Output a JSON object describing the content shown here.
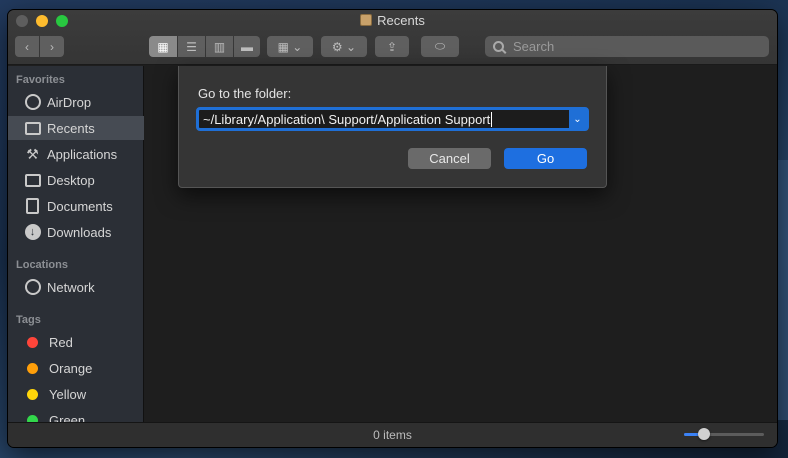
{
  "window": {
    "title": "Recents"
  },
  "search": {
    "placeholder": "Search"
  },
  "sidebar": {
    "favorites_header": "Favorites",
    "favorites": [
      {
        "label": "AirDrop",
        "icon": "airdrop-icon"
      },
      {
        "label": "Recents",
        "icon": "recents-icon",
        "selected": true
      },
      {
        "label": "Applications",
        "icon": "applications-icon"
      },
      {
        "label": "Desktop",
        "icon": "desktop-icon"
      },
      {
        "label": "Documents",
        "icon": "documents-icon"
      },
      {
        "label": "Downloads",
        "icon": "downloads-icon"
      }
    ],
    "locations_header": "Locations",
    "locations": [
      {
        "label": "Network",
        "icon": "network-icon"
      }
    ],
    "tags_header": "Tags",
    "tags": [
      {
        "label": "Red",
        "color": "#ff453a"
      },
      {
        "label": "Orange",
        "color": "#ff9f0a"
      },
      {
        "label": "Yellow",
        "color": "#ffd60a"
      },
      {
        "label": "Green",
        "color": "#32d74b"
      }
    ]
  },
  "status": {
    "items_text": "0 items",
    "icon_size_fraction": 0.25
  },
  "dialog": {
    "label": "Go to the folder:",
    "path_value": "~/Library/Application\\ Support/Application Support",
    "cancel_label": "Cancel",
    "go_label": "Go"
  },
  "colors": {
    "accent": "#1e6fe0"
  }
}
